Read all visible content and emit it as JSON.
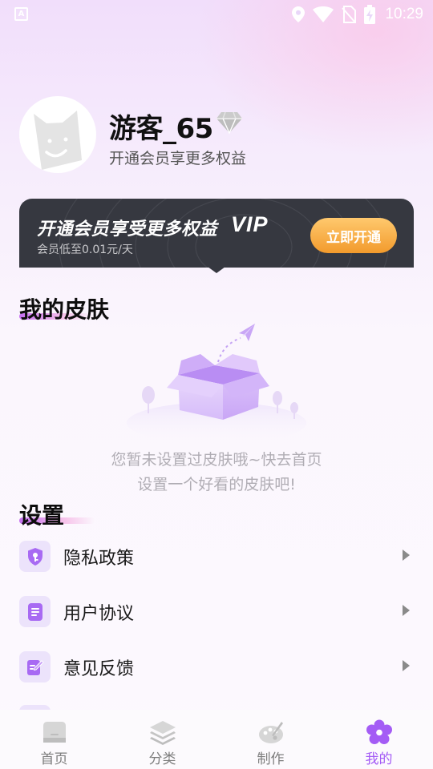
{
  "status_bar": {
    "time": "10:29",
    "app_icon_letter": "A",
    "icons": [
      "location-icon",
      "wifi-icon",
      "no-sim-icon",
      "battery-charging-icon"
    ]
  },
  "profile": {
    "username": "游客_65",
    "subtitle": "开通会员享更多权益",
    "badge_icon": "diamond-icon"
  },
  "vip_banner": {
    "title": "开通会员享受更多权益",
    "vip_word": "VIP",
    "subtitle": "会员低至0.01元/天",
    "button_label": "立即开通"
  },
  "skins": {
    "title": "我的皮肤",
    "empty_line1": "您暂未设置过皮肤哦~快去首页",
    "empty_line2": "设置一个好看的皮肤吧!"
  },
  "settings": {
    "title": "设置",
    "items": [
      {
        "label": "隐私政策",
        "icon": "shield-key-icon"
      },
      {
        "label": "用户协议",
        "icon": "document-icon"
      },
      {
        "label": "意见反馈",
        "icon": "edit-icon"
      }
    ]
  },
  "bottom_nav": {
    "items": [
      {
        "label": "首页",
        "icon": "home-icon",
        "active": false
      },
      {
        "label": "分类",
        "icon": "layers-icon",
        "active": false
      },
      {
        "label": "制作",
        "icon": "palette-icon",
        "active": false
      },
      {
        "label": "我的",
        "icon": "flower-icon",
        "active": true
      }
    ]
  },
  "colors": {
    "accent": "#a45cf5",
    "vip_banner_bg": "#363840",
    "vip_button": "#f5a73c",
    "inactive_nav": "#7d7d7d"
  }
}
